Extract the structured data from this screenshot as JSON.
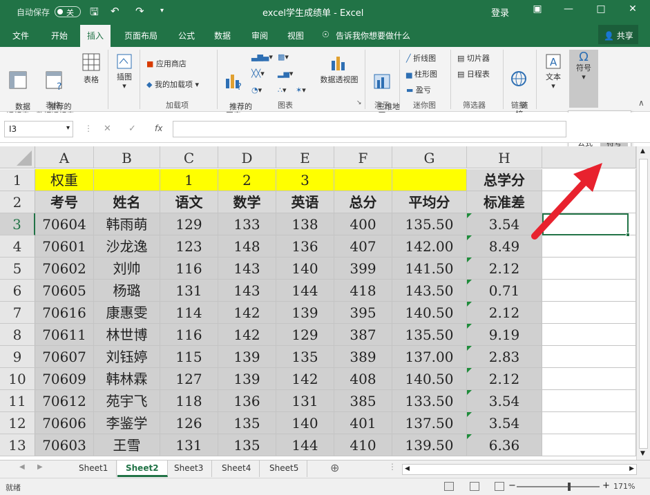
{
  "titlebar": {
    "autosave_label": "自动保存",
    "autosave_state": "关",
    "title": "excel学生成绩单  -  Excel",
    "login": "登录"
  },
  "tabs": [
    "文件",
    "开始",
    "插入",
    "页面布局",
    "公式",
    "数据",
    "审阅",
    "视图"
  ],
  "active_tab": "插入",
  "tell_me": "告诉我你想要做什么",
  "share": "共享",
  "ribbon": {
    "pivot_table": "数据\n透视表",
    "recommended_pivot": "推荐的\n数据透视表",
    "table": "表格",
    "group_tables": "表格",
    "illustrations": "插图",
    "store": "应用商店",
    "my_addins": "我的加载项",
    "group_addins": "加载项",
    "recommended_charts": "推荐的\n图表",
    "group_charts": "图表",
    "pivot_chart": "数据透视图",
    "map_3d": "三维地\n图",
    "group_tours": "演示",
    "line": "折线图",
    "column": "柱形图",
    "win_loss": "盈亏",
    "group_sparklines": "迷你图",
    "slicer": "切片器",
    "timeline": "日程表",
    "group_filters": "筛选器",
    "link": "链\n接",
    "group_links": "链接",
    "text": "文本",
    "symbols": "符号"
  },
  "popup": {
    "equation": "公式",
    "symbol": "符号",
    "group_partial": "号"
  },
  "namebox": "I3",
  "fx": "fx",
  "columns": [
    "A",
    "B",
    "C",
    "D",
    "E",
    "F",
    "G",
    "H"
  ],
  "rows": [
    "1",
    "2",
    "3",
    "4",
    "5",
    "6",
    "7",
    "8",
    "9",
    "10",
    "11",
    "12",
    "13"
  ],
  "sheet": {
    "row1": [
      "权重",
      "",
      "1",
      "2",
      "3",
      "",
      "",
      "总学分"
    ],
    "row2": [
      "考号",
      "姓名",
      "语文",
      "数学",
      "英语",
      "总分",
      "平均分",
      "标准差"
    ],
    "data": [
      [
        "70604",
        "韩雨萌",
        "129",
        "133",
        "138",
        "400",
        "135.50",
        "3.54"
      ],
      [
        "70601",
        "沙龙逸",
        "123",
        "148",
        "136",
        "407",
        "142.00",
        "8.49"
      ],
      [
        "70602",
        "刘帅",
        "116",
        "143",
        "140",
        "399",
        "141.50",
        "2.12"
      ],
      [
        "70605",
        "杨璐",
        "131",
        "143",
        "144",
        "418",
        "143.50",
        "0.71"
      ],
      [
        "70616",
        "康惠雯",
        "114",
        "142",
        "139",
        "395",
        "140.50",
        "2.12"
      ],
      [
        "70611",
        "林世博",
        "116",
        "142",
        "129",
        "387",
        "135.50",
        "9.19"
      ],
      [
        "70607",
        "刘钰婷",
        "115",
        "139",
        "135",
        "389",
        "137.00",
        "2.83"
      ],
      [
        "70609",
        "韩林霖",
        "127",
        "139",
        "142",
        "408",
        "140.50",
        "2.12"
      ],
      [
        "70612",
        "苑宇飞",
        "118",
        "136",
        "131",
        "385",
        "133.50",
        "3.54"
      ],
      [
        "70606",
        "李鉴学",
        "126",
        "135",
        "140",
        "401",
        "137.50",
        "3.54"
      ],
      [
        "70603",
        "王雪",
        "131",
        "135",
        "144",
        "410",
        "139.50",
        "6.36"
      ]
    ]
  },
  "sheet_tabs": [
    "Sheet1",
    "Sheet2",
    "Sheet3",
    "Sheet4",
    "Sheet5"
  ],
  "active_sheet": "Sheet2",
  "status": {
    "ready": "就绪",
    "zoom": "171%"
  },
  "colors": {
    "excel_green": "#217346",
    "weight_row": "#ffff00",
    "header_gray": "#d9d9d9",
    "data_gray": "#d0d0d0",
    "arrow": "#e8222e"
  }
}
